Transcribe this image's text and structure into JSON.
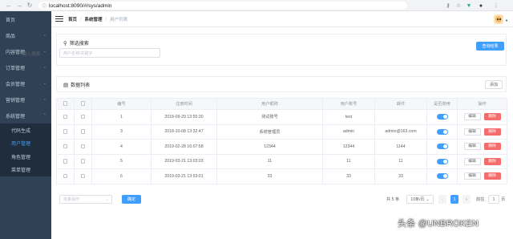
{
  "browser": {
    "url": "localhost:8090/#/sys/admin",
    "url_security": "ⓘ"
  },
  "sidebar": {
    "items": [
      {
        "label": "首页",
        "expandable": false
      },
      {
        "label": "商品",
        "expandable": true
      },
      {
        "label": "内容管理",
        "expandable": true
      },
      {
        "label": "订单管理",
        "expandable": true
      },
      {
        "label": "会员管理",
        "expandable": true
      },
      {
        "label": "营销管理",
        "expandable": true
      },
      {
        "label": "系统管理",
        "expandable": true
      }
    ],
    "sub_items": [
      {
        "label": "代码生成"
      },
      {
        "label": "用户管理",
        "active": true
      },
      {
        "label": "角色管理"
      },
      {
        "label": "菜单管理"
      }
    ],
    "active_color": "#409eff"
  },
  "header": {
    "breadcrumb": [
      "首页",
      "系统管理",
      "用户列表"
    ]
  },
  "filter": {
    "title": "筛选搜索",
    "search_button": "查询结果",
    "input_label": "输入搜索:",
    "input_placeholder": "用户名称/关键字"
  },
  "list": {
    "title": "数据列表",
    "add_button": "添加",
    "columns": [
      "",
      "",
      "编号",
      "注册时间",
      "用户昵称",
      "用户账号",
      "邮件",
      "是否禁用",
      "操作"
    ],
    "rows": [
      {
        "id": "1",
        "time": "2018-09-29 13:55:30",
        "nick": "测试账号",
        "account": "test",
        "email": "",
        "enabled": true
      },
      {
        "id": "3",
        "time": "2018-10-08 13:32:47",
        "nick": "系统管理员",
        "account": "admin",
        "email": "admin@163.com",
        "enabled": true
      },
      {
        "id": "4",
        "time": "2019-02-28 16:07:58",
        "nick": "12344",
        "account": "12344",
        "email": "1144",
        "enabled": true
      },
      {
        "id": "5",
        "time": "2019-03-21 13:03:03",
        "nick": "11",
        "account": "11",
        "email": "11",
        "enabled": true
      },
      {
        "id": "6",
        "time": "2019-03-21 13:53:01",
        "nick": "33",
        "account": "33",
        "email": "33",
        "enabled": true
      }
    ],
    "edit_label": "编辑",
    "delete_label": "删除"
  },
  "footer": {
    "batch_placeholder": "批量操作",
    "confirm_button": "确定",
    "total_text": "共 5 条",
    "page_size": "10条/页",
    "current_page": "1",
    "goto_label": "前往",
    "goto_value": "1",
    "page_unit": "页"
  },
  "watermark": "头条 @UNBROKEN"
}
